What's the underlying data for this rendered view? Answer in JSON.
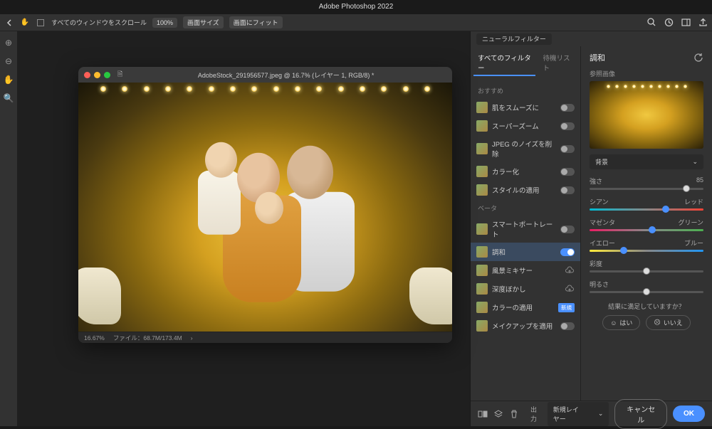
{
  "app_title": "Adobe Photoshop 2022",
  "toolbar": {
    "scroll_all": "すべてのウィンドウをスクロール",
    "zoom": "100%",
    "fit_screen": "画面サイズ",
    "fit_image": "画面にフィット"
  },
  "document": {
    "title": "AdobeStock_291956577.jpeg @ 16.7% (レイヤー 1, RGB/8) *",
    "zoom": "16.67%",
    "file_info": "ファイル：68.7M/173.4M"
  },
  "panel": {
    "tab": "ニューラルフィルター",
    "tabs": {
      "all": "すべてのフィルター",
      "wait": "待機リスト"
    },
    "sections": {
      "recommended": "おすすめ",
      "beta": "ベータ"
    },
    "filters_recommended": [
      {
        "label": "肌をスムーズに",
        "toggle": false
      },
      {
        "label": "スーパーズーム",
        "toggle": false
      },
      {
        "label": "JPEG のノイズを削除",
        "toggle": false
      },
      {
        "label": "カラー化",
        "toggle": false
      },
      {
        "label": "スタイルの適用",
        "toggle": false
      }
    ],
    "filters_beta": [
      {
        "label": "スマートポートレート",
        "toggle": false
      },
      {
        "label": "調和",
        "toggle": true,
        "active": true
      },
      {
        "label": "風景ミキサー",
        "cloud": true
      },
      {
        "label": "深度ぼかし",
        "cloud": true
      },
      {
        "label": "カラーの適用",
        "badge": "新規"
      },
      {
        "label": "メイクアップを適用",
        "toggle": false
      }
    ]
  },
  "settings": {
    "title": "調和",
    "ref_label": "参照画像",
    "dropdown": "背景",
    "sliders": {
      "strength": {
        "label": "強さ",
        "value": 85,
        "pos": 85
      },
      "cyan_red": {
        "left": "シアン",
        "right": "レッド",
        "pos": 67
      },
      "magenta_green": {
        "left": "マゼンタ",
        "right": "グリーン",
        "pos": 55
      },
      "yellow_blue": {
        "left": "イエロー",
        "right": "ブルー",
        "pos": 30
      },
      "saturation": {
        "label": "彩度",
        "pos": 50
      },
      "brightness": {
        "label": "明るさ",
        "pos": 50
      }
    },
    "satisfied_q": "結果に満足していますか？",
    "yes": "はい",
    "no": "いいえ"
  },
  "footer": {
    "output_label": "出力",
    "output_value": "新規レイヤー",
    "cancel": "キャンセル",
    "ok": "OK"
  }
}
